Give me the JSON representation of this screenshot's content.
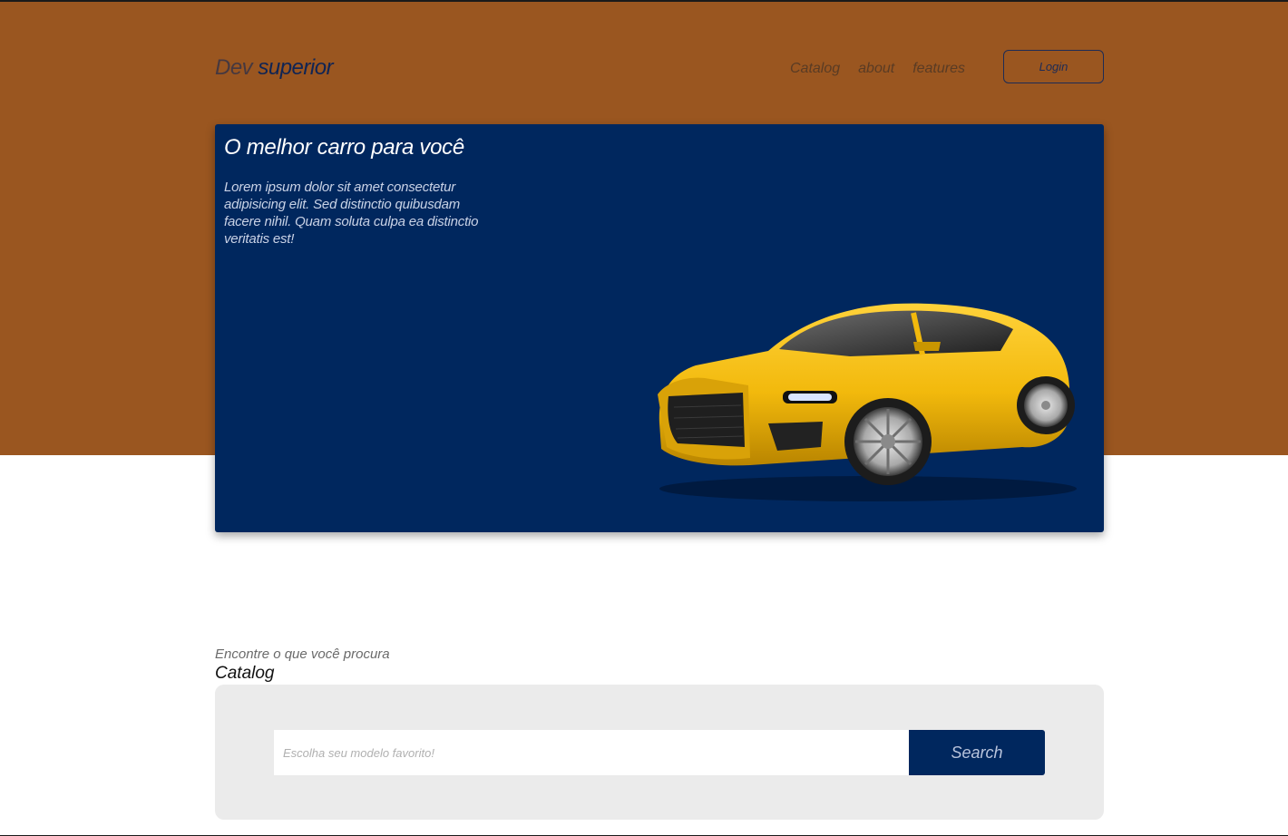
{
  "header": {
    "logo_dev": "Dev",
    "logo_superior": "superior",
    "nav": [
      {
        "label": "Catalog"
      },
      {
        "label": "about"
      },
      {
        "label": "features"
      }
    ],
    "login_label": "Login"
  },
  "hero": {
    "title": "O melhor carro para você",
    "text": "Lorem ipsum dolor sit amet consectetur adipisicing elit. Sed distinctio quibusdam facere nihil. Quam soluta culpa ea distinctio veritatis est!"
  },
  "catalog": {
    "subtitle": "Encontre o que você procura",
    "title": "Catalog",
    "search_placeholder": "Escolha seu modelo favorito!",
    "search_button": "Search"
  },
  "colors": {
    "hero_background": "#9a5620",
    "card_background": "#00275e",
    "car_body": "#f2b90c",
    "panel_background": "#ebebeb"
  }
}
